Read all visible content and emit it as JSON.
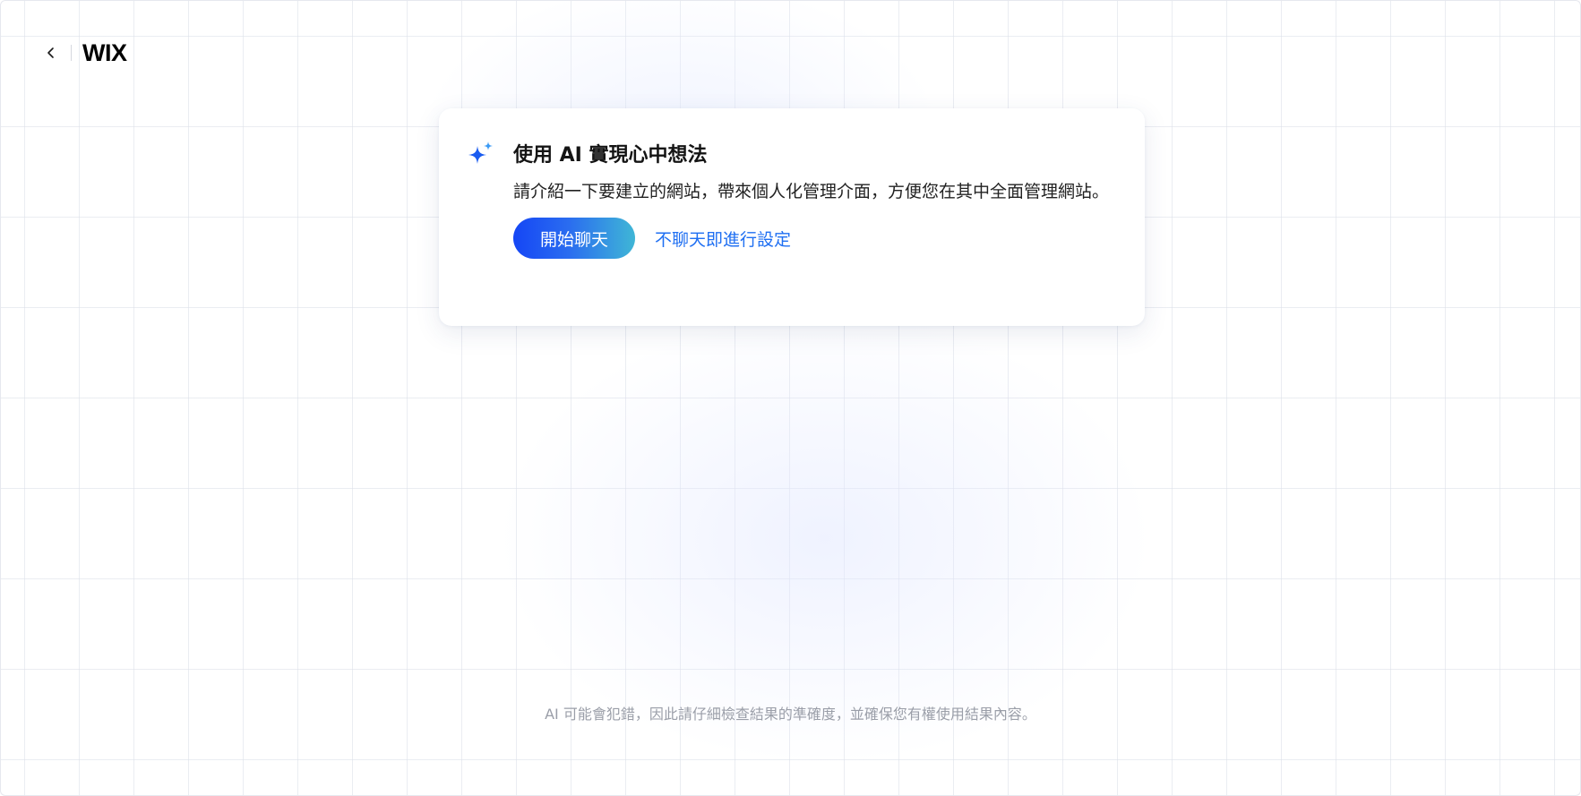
{
  "header": {
    "back_icon": "chevron-left-icon",
    "logo_text": "WIX"
  },
  "card": {
    "icon": "sparkle-icon",
    "title": "使用 AI 實現心中想法",
    "description": "請介紹一下要建立的網站，帶來個人化管理介面，方便您在其中全面管理網站。",
    "start_button_label": "開始聊天",
    "skip_link_label": "不聊天即進行設定"
  },
  "footer": {
    "disclaimer": "AI 可能會犯錯，因此請仔細檢查結果的準確度，並確保您有權使用結果內容。"
  },
  "colors": {
    "accent": "#1f6ff2",
    "button_gradient_start": "#1546f5",
    "button_gradient_end": "#3fb6d6",
    "sparkle_dark": "#1a5cf0",
    "sparkle_light": "#3b9bf5"
  }
}
